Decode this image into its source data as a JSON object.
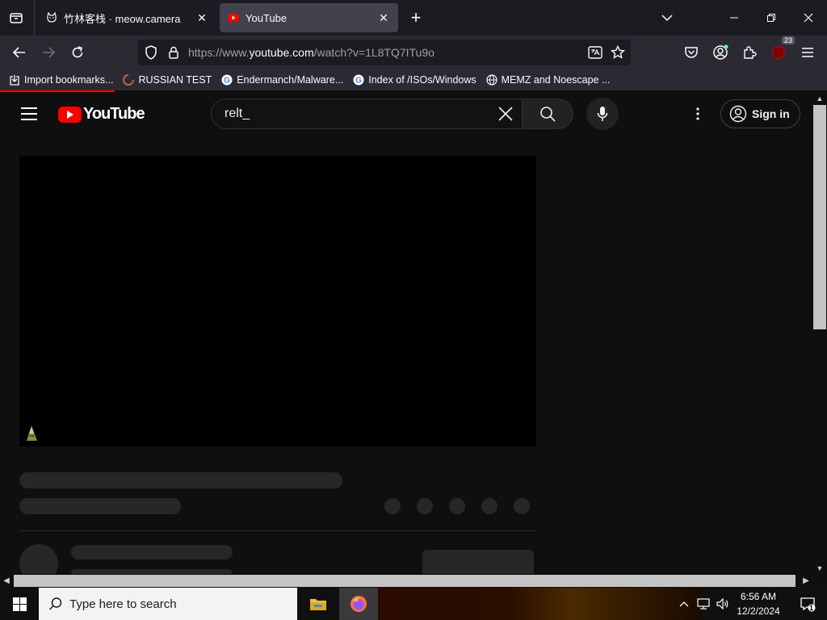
{
  "browser": {
    "tabs": [
      {
        "title": "竹林客栈 · meow.camera",
        "active": false,
        "favicon": "cat-icon"
      },
      {
        "title": "YouTube",
        "active": true,
        "favicon": "youtube-icon"
      }
    ],
    "url_prefix": "https://www.",
    "url_domain": "youtube.com",
    "url_path": "/watch?v=1L8TQ7ITu9o",
    "extension_badge": "23",
    "bookmarks": [
      {
        "label": "Import bookmarks...",
        "icon": "import-icon"
      },
      {
        "label": "RUSSIAN TEST",
        "icon": "loading-icon"
      },
      {
        "label": "Endermanch/Malware...",
        "icon": "google-icon"
      },
      {
        "label": "Index of /ISOs/Windows",
        "icon": "google-icon"
      },
      {
        "label": "MEMZ and Noescape ...",
        "icon": "globe-icon"
      }
    ]
  },
  "youtube": {
    "logo_text": "YouTube",
    "search_query": "relt_",
    "sign_in_label": "Sign in"
  },
  "taskbar": {
    "search_placeholder": "Type here to search",
    "time": "6:56 AM",
    "date": "12/2/2024",
    "notification_count": "1"
  },
  "colors": {
    "youtube_red": "#ff0000",
    "page_bg": "#0f0f0f",
    "skeleton": "#272727",
    "chrome_tabbar": "#1c1b22",
    "chrome_toolbar": "#2b2a33"
  }
}
